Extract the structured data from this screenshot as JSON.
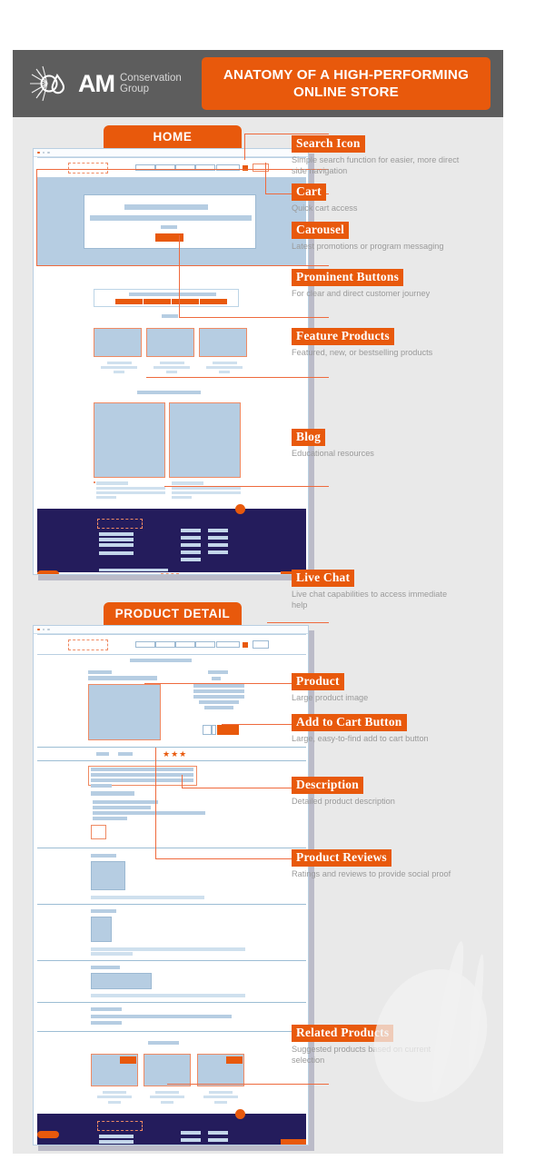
{
  "header": {
    "logo": {
      "mark": "sunburst-droplet-logo",
      "initials": "AM",
      "line1": "Conservation",
      "line2": "Group"
    },
    "title_line1": "ANATOMY OF A HIGH-PERFORMING",
    "title_line2": "ONLINE STORE",
    "bg_color": "#5d5d5d",
    "accent_color": "#e8590c"
  },
  "sections": [
    {
      "id": "home",
      "tab_label": "HOME"
    },
    {
      "id": "pdp",
      "tab_label": "PRODUCT DETAIL"
    }
  ],
  "annotations_home": [
    {
      "tag": "Search Icon",
      "desc": "Simple search function for easier, more direct side navigation"
    },
    {
      "tag": "Cart",
      "desc": "Quick cart access"
    },
    {
      "tag": "Carousel",
      "desc": "Latest promotions or program messaging"
    },
    {
      "tag": "Prominent Buttons",
      "desc": "For clear and direct customer journey"
    },
    {
      "tag": "Feature Products",
      "desc": "Featured, new, or bestselling products"
    },
    {
      "tag": "Blog",
      "desc": "Educational resources"
    },
    {
      "tag": "Live Chat",
      "desc": "Live chat capabilities to access immediate help"
    }
  ],
  "annotations_pdp": [
    {
      "tag": "Product",
      "desc": "Large product image"
    },
    {
      "tag": "Add to Cart Button",
      "desc": "Large, easy-to-find add to cart button"
    },
    {
      "tag": "Description",
      "desc": "Detailed product description"
    },
    {
      "tag": "Product Reviews",
      "desc": "Ratings and reviews to provide social proof"
    },
    {
      "tag": "Related Products",
      "desc": "Suggested products based on current selection"
    }
  ],
  "wireframe": {
    "browser_dots": [
      "close-dot",
      "minimize-dot",
      "maximize-dot"
    ],
    "rating_stars": "★★★",
    "palette": {
      "wire_fill": "#b6cde2",
      "wire_stroke": "#9cb9d2",
      "highlight": "#ef8a63",
      "orange": "#e8590c",
      "footer_navy": "#241c5c",
      "canvas": "#e9e9e9"
    }
  }
}
